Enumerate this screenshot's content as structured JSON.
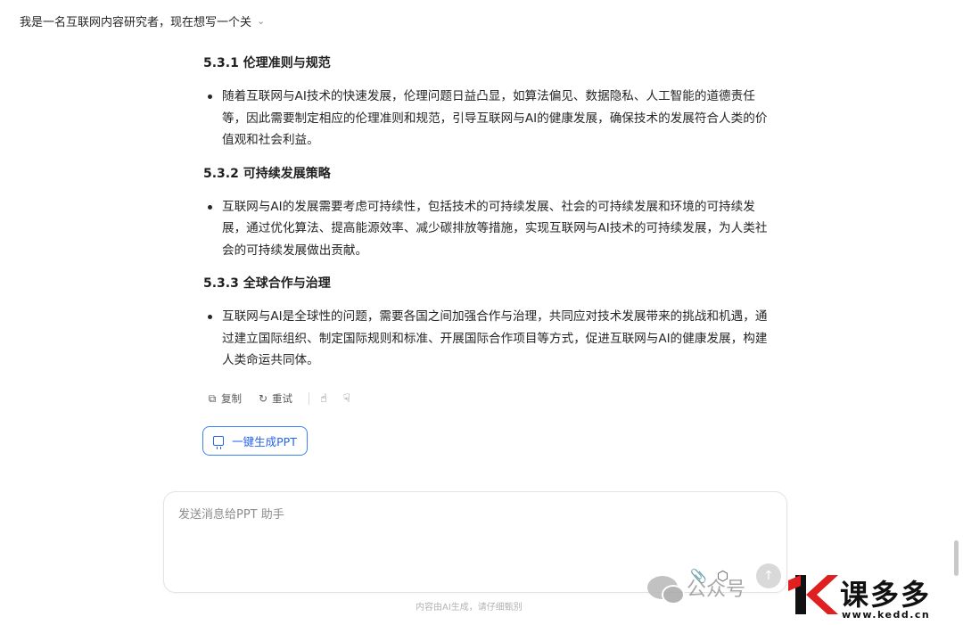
{
  "header": {
    "title": "我是一名互联网内容研究者，现在想写一个关",
    "chevron_icon": "chevron-down-icon"
  },
  "sections": [
    {
      "title": "5.3.1 伦理准则与规范",
      "bullet": "随着互联网与AI技术的快速发展，伦理问题日益凸显，如算法偏见、数据隐私、人工智能的道德责任等，因此需要制定相应的伦理准则和规范，引导互联网与AI的健康发展，确保技术的发展符合人类的价值观和社会利益。"
    },
    {
      "title": "5.3.2 可持续发展策略",
      "bullet": "互联网与AI的发展需要考虑可持续性，包括技术的可持续发展、社会的可持续发展和环境的可持续发展，通过优化算法、提高能源效率、减少碳排放等措施，实现互联网与AI技术的可持续发展，为人类社会的可持续发展做出贡献。"
    },
    {
      "title": "5.3.3 全球合作与治理",
      "bullet": "互联网与AI是全球性的问题，需要各国之间加强合作与治理，共同应对技术发展带来的挑战和机遇，通过建立国际组织、制定国际规则和标准、开展国际合作项目等方式，促进互联网与AI的健康发展，构建人类命运共同体。"
    }
  ],
  "actions": {
    "copy_label": "复制",
    "retry_label": "重试",
    "copy_icon": "copy-icon",
    "retry_icon": "refresh-icon",
    "like_icon": "thumbs-up-icon",
    "dislike_icon": "thumbs-down-icon"
  },
  "ppt_button": {
    "label": "一键生成PPT",
    "icon": "presentation-icon"
  },
  "input": {
    "placeholder": "发送消息给PPT 助手",
    "value": ""
  },
  "footer_note": "内容由AI生成，请仔细甄别",
  "watermark": {
    "wechat_text": "公众号",
    "brand": "课多多",
    "url": "www.kedd.cn"
  },
  "colors": {
    "accent": "#2563eb",
    "brand_red": "#e02020"
  }
}
